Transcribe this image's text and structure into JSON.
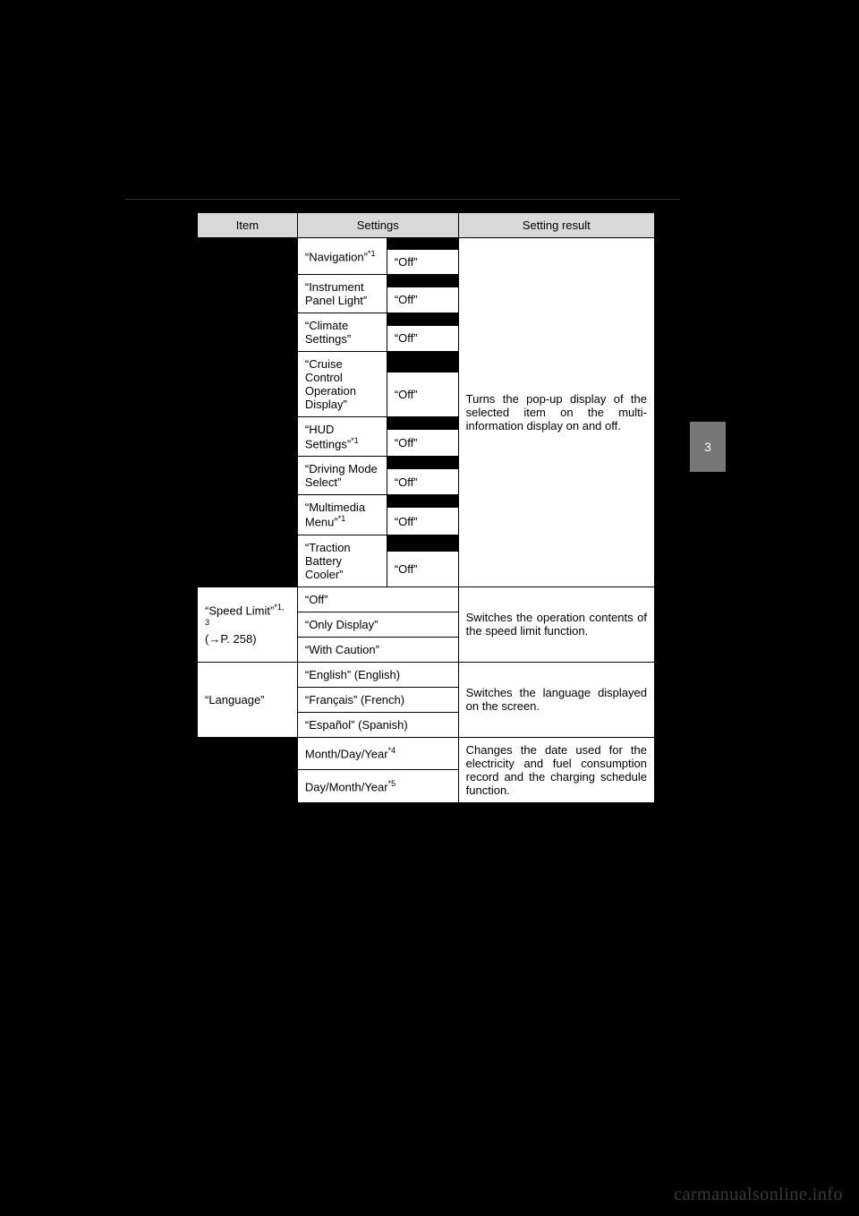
{
  "sideTab": "3",
  "watermark": "carmanualsonline.info",
  "headers": {
    "item": "Item",
    "settings": "Settings",
    "result": "Setting result"
  },
  "popup": {
    "item_hidden": "",
    "subs": [
      {
        "label": "“Navigation”",
        "sup": "*1",
        "off": "“Off”"
      },
      {
        "label": "“Instrument Panel Light”",
        "sup": "",
        "off": "“Off”"
      },
      {
        "label": "“Climate Settings”",
        "sup": "",
        "off": "“Off”"
      },
      {
        "label": "“Cruise Control Operation Display”",
        "sup": "",
        "off": "“Off”"
      },
      {
        "label": "“HUD Settings”",
        "sup": "*1",
        "off": "“Off”"
      },
      {
        "label": "“Driving Mode Select”",
        "sup": "",
        "off": "“Off”"
      },
      {
        "label": "“Multimedia Menu”",
        "sup": "*1",
        "off": "“Off”"
      },
      {
        "label": "“Traction Battery Cooler”",
        "sup": "",
        "off": "“Off”"
      }
    ],
    "result": "Turns the pop-up display of the selected item on the multi-information display on and off."
  },
  "speed": {
    "item_pre": "“Speed Limit”",
    "item_sup": "*1, 3",
    "item_ref": "(→P. 258)",
    "opts": [
      "“Off”",
      "“Only Display”",
      "“With Caution”"
    ],
    "result": "Switches the operation con­tents of the speed limit func­tion."
  },
  "lang": {
    "item": "“Language”",
    "opts": [
      "“English” (English)",
      "“Français” (French)",
      "“Español” (Spanish)"
    ],
    "result": "Switches the language dis­played on the screen."
  },
  "date": {
    "item_hidden": "",
    "opts": [
      {
        "text": "Month/Day/Year",
        "sup": "*4"
      },
      {
        "text": "Day/Month/Year",
        "sup": "*5"
      }
    ],
    "result": "Changes the date used for the electricity and fuel consump­tion record and the charging schedule function."
  }
}
